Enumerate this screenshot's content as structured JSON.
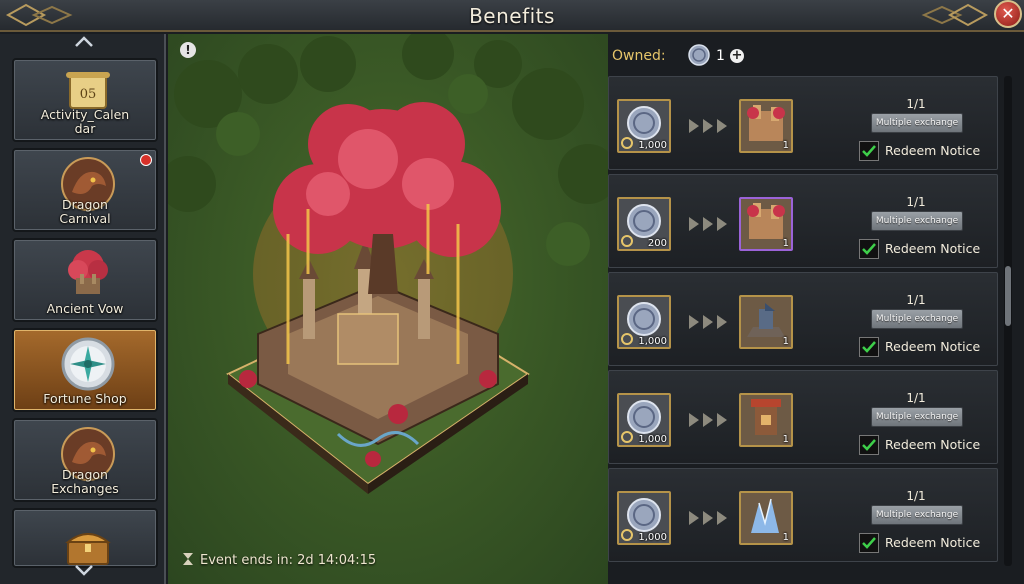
{
  "window": {
    "title": "Benefits",
    "close_icon": "close-x-icon"
  },
  "sidebar": {
    "items": [
      {
        "label": "Activity_Calen\ndar",
        "icon": "calendar-scroll-icon",
        "icon_text": "05",
        "active": false,
        "badge": false
      },
      {
        "label": "Dragon\nCarnival",
        "icon": "dragon-head-icon",
        "active": false,
        "badge": true
      },
      {
        "label": "Ancient Vow",
        "icon": "red-tree-castle-icon",
        "active": false,
        "badge": false
      },
      {
        "label": "Fortune Shop",
        "icon": "compass-medal-icon",
        "active": true,
        "badge": false
      },
      {
        "label": "Dragon\nExchanges",
        "icon": "dragon-head-icon",
        "active": false,
        "badge": false
      },
      {
        "label": "",
        "icon": "treasure-chest-icon",
        "active": false,
        "badge": false
      }
    ]
  },
  "art": {
    "event_ends": "Event ends in: 2d 14:04:15",
    "info_icon": "!"
  },
  "owned": {
    "label": "Owned:",
    "count": "1",
    "plus": "+"
  },
  "exchanges": [
    {
      "cost": "1,000",
      "reward_qty": "1",
      "reward": "fortress-tile",
      "purple": false,
      "limit": "1/1",
      "button": "Multiple exchange",
      "notice": "Redeem Notice"
    },
    {
      "cost": "200",
      "reward_qty": "1",
      "reward": "fortress-tile",
      "purple": true,
      "limit": "1/1",
      "button": "Multiple exchange",
      "notice": "Redeem Notice"
    },
    {
      "cost": "1,000",
      "reward_qty": "1",
      "reward": "catapult-tile",
      "purple": false,
      "limit": "1/1",
      "button": "Multiple exchange",
      "notice": "Redeem Notice"
    },
    {
      "cost": "1,000",
      "reward_qty": "1",
      "reward": "tower-tile",
      "purple": false,
      "limit": "1/1",
      "button": "Multiple exchange",
      "notice": "Redeem Notice"
    },
    {
      "cost": "1,000",
      "reward_qty": "1",
      "reward": "ice-crystal-tile",
      "purple": false,
      "limit": "1/1",
      "button": "Multiple exchange",
      "notice": "Redeem Notice"
    }
  ],
  "colors": {
    "accent_gold": "#e6c56a",
    "active_tab": "#a56a2c",
    "close_red": "#b02a22",
    "check_green": "#3ecf4a"
  }
}
